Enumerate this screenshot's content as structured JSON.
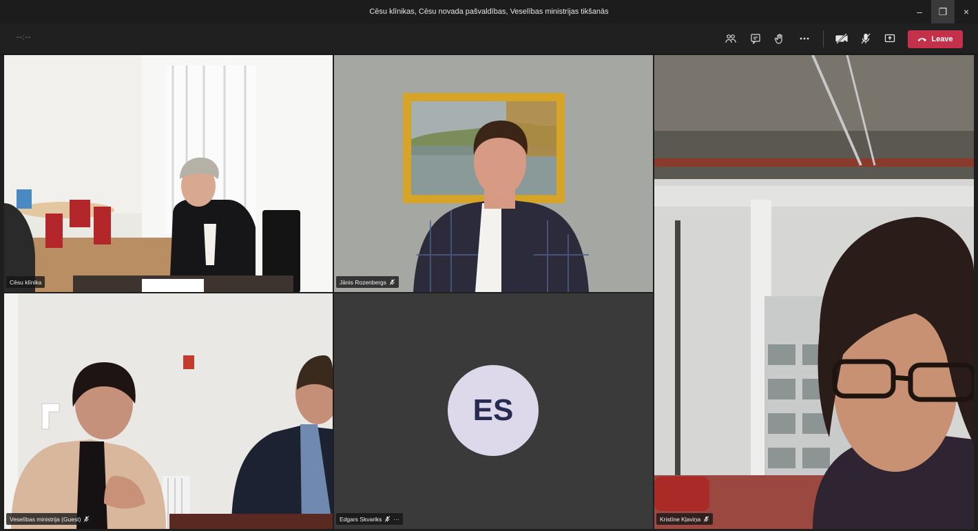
{
  "window": {
    "title": "Cēsu klīnikas, Cēsu novada pašvaldības, Veselības ministrijas tikšanās",
    "minimize": "–",
    "restore": "❐",
    "close": "×"
  },
  "toolbar": {
    "timer": "--:--",
    "leave_label": "Leave",
    "icons": [
      "participants-icon",
      "chat-icon",
      "raise-hand-icon",
      "more-icon",
      "camera-off-icon",
      "mic-off-icon",
      "share-screen-icon"
    ]
  },
  "participants": [
    {
      "name": "Cēsu klīnika",
      "muted": false
    },
    {
      "name": "Jānis Rozenbergs",
      "muted": true
    },
    {
      "name": "Kristīne Kļaviņa",
      "muted": true
    },
    {
      "name": "Veselības ministrija (Guest)",
      "muted": true
    },
    {
      "name": "Edgars Skvariks",
      "muted": true,
      "initials": "ES",
      "more": "···"
    }
  ],
  "colors": {
    "leave": "#c4314b",
    "avatar_bg": "#ddd8ea",
    "avatar_text": "#272a52"
  }
}
